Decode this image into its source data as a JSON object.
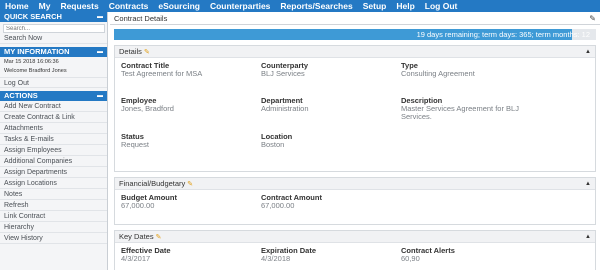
{
  "nav": [
    "Home",
    "My",
    "Requests",
    "Contracts",
    "eSourcing",
    "Counterparties",
    "Reports/Searches",
    "Setup",
    "Help",
    "Log Out"
  ],
  "sidebar": {
    "quick_search_title": "QUICK SEARCH",
    "search_placeholder": "Search...",
    "search_now": "Search Now",
    "my_info_title": "MY INFORMATION",
    "timestamp": "Mar 15 2018 16:06:36",
    "welcome": "Welcome Bradford Jones",
    "logout": "Log Out",
    "actions_title": "ACTIONS",
    "actions": [
      "Add New Contract",
      "Create Contract & Link",
      "Attachments",
      "Tasks & E-mails",
      "Assign Employees",
      "Additional Companies",
      "Assign Departments",
      "Assign Locations",
      "Notes",
      "Refresh",
      "Link Contract",
      "Hierarchy",
      "View History"
    ]
  },
  "main": {
    "breadcrumb": "Contract Details",
    "progress": {
      "text": "19 days remaining; term days: 365; term months: 12",
      "fraction": 0.95
    },
    "details": {
      "title": "Details",
      "contract_title_label": "Contract Title",
      "contract_title_value": "Test Agreement for MSA",
      "counterparty_label": "Counterparty",
      "counterparty_value": "BLJ Services",
      "type_label": "Type",
      "type_value": "Consulting Agreement",
      "employee_label": "Employee",
      "employee_value": "Jones, Bradford",
      "department_label": "Department",
      "department_value": "Administration",
      "description_label": "Description",
      "description_value": "Master Services Agreement for BLJ Services.",
      "status_label": "Status",
      "status_value": "Request",
      "location_label": "Location",
      "location_value": "Boston"
    },
    "financial": {
      "title": "Financial/Budgetary",
      "budget_label": "Budget Amount",
      "budget_value": "67,000.00",
      "contract_amount_label": "Contract Amount",
      "contract_amount_value": "67,000.00"
    },
    "key_dates": {
      "title": "Key Dates",
      "effective_label": "Effective Date",
      "effective_value": "4/3/2017",
      "expiration_label": "Expiration Date",
      "expiration_value": "4/3/2018",
      "alerts_label": "Contract Alerts",
      "alerts_value": "60,90"
    }
  }
}
